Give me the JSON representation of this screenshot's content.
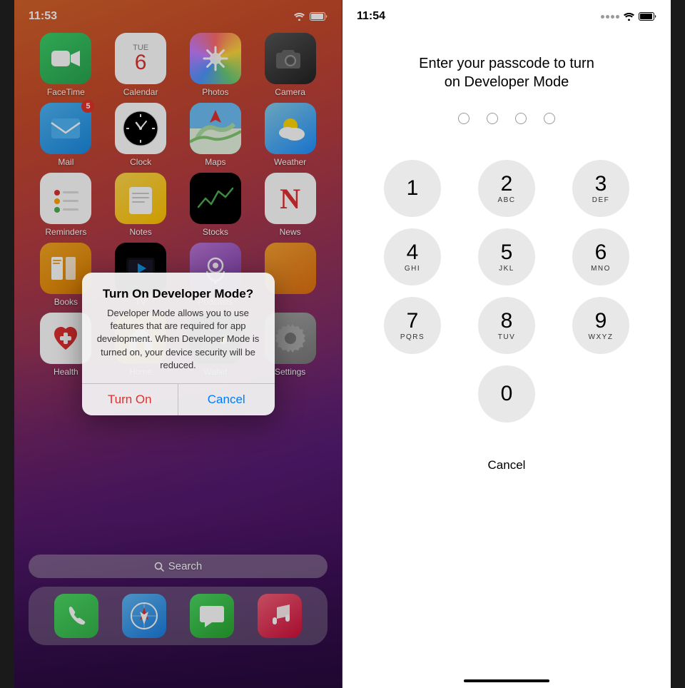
{
  "left_phone": {
    "status_bar": {
      "time": "11:53",
      "wifi": "wifi",
      "battery": "battery"
    },
    "apps_row1": [
      {
        "label": "FaceTime",
        "icon_class": "icon-facetime",
        "icon_char": "📹"
      },
      {
        "label": "Calendar",
        "icon_class": "icon-calendar",
        "special": "calendar"
      },
      {
        "label": "Photos",
        "icon_class": "icon-photos",
        "special": "photos"
      },
      {
        "label": "Camera",
        "icon_class": "icon-camera",
        "icon_char": "📷"
      }
    ],
    "apps_row2": [
      {
        "label": "Mail",
        "icon_class": "icon-mail",
        "icon_char": "✉️",
        "badge": "5"
      },
      {
        "label": "Clock",
        "icon_class": "icon-clock",
        "special": "clock"
      },
      {
        "label": "Maps",
        "icon_class": "icon-maps",
        "icon_char": "🗺️"
      },
      {
        "label": "Weather",
        "icon_class": "icon-weather",
        "icon_char": "⛅"
      }
    ],
    "apps_row3": [
      {
        "label": "Reminders",
        "icon_class": "icon-reminders",
        "special": "reminders"
      },
      {
        "label": "Notes",
        "icon_class": "icon-notes",
        "icon_char": "📝"
      },
      {
        "label": "Stocks",
        "icon_class": "icon-stocks",
        "special": "stocks"
      },
      {
        "label": "News",
        "icon_class": "icon-news",
        "special": "news"
      }
    ],
    "apps_row4": [
      {
        "label": "Books",
        "icon_class": "icon-books",
        "icon_char": "📚"
      },
      {
        "label": "TV",
        "icon_class": "icon-tv",
        "icon_char": "📺"
      },
      {
        "label": "Podcasts",
        "icon_class": "icon-podcasts",
        "icon_char": "🎙️"
      },
      {
        "label": "",
        "icon_class": "icon-orange",
        "icon_char": ""
      }
    ],
    "apps_bottom": [
      {
        "label": "Health",
        "icon_class": "icon-health",
        "icon_char": "❤️"
      },
      {
        "label": "Home",
        "icon_class": "icon-home",
        "icon_char": "🏠"
      },
      {
        "label": "Wallet",
        "icon_class": "icon-wallet",
        "icon_char": "💳"
      },
      {
        "label": "Settings",
        "icon_class": "icon-settings",
        "icon_char": "⚙️"
      }
    ],
    "dialog": {
      "title": "Turn On Developer Mode?",
      "message": "Developer Mode allows you to use features that are required for app development. When Developer Mode is turned on, your device security will be reduced.",
      "btn_turn_on": "Turn On",
      "btn_cancel": "Cancel"
    },
    "search_bar": {
      "text": "Search",
      "icon": "search"
    },
    "dock": [
      {
        "label": "Phone",
        "icon_class": "icon-phone",
        "icon_char": "📞"
      },
      {
        "label": "Safari",
        "icon_class": "icon-safari",
        "icon_char": "🧭"
      },
      {
        "label": "Messages",
        "icon_class": "icon-messages",
        "icon_char": "💬"
      },
      {
        "label": "Music",
        "icon_class": "icon-music",
        "icon_char": "🎵"
      }
    ],
    "calendar_day": "TUE",
    "calendar_date": "6"
  },
  "right_phone": {
    "status_bar": {
      "time": "11:54",
      "wifi": "wifi",
      "battery": "battery"
    },
    "passcode_title": "Enter your passcode to turn on Developer Mode",
    "passcode_dots_count": 4,
    "numpad": [
      {
        "num": "1",
        "letters": ""
      },
      {
        "num": "2",
        "letters": "ABC"
      },
      {
        "num": "3",
        "letters": "DEF"
      },
      {
        "num": "4",
        "letters": "GHI"
      },
      {
        "num": "5",
        "letters": "JKL"
      },
      {
        "num": "6",
        "letters": "MNO"
      },
      {
        "num": "7",
        "letters": "PQRS"
      },
      {
        "num": "8",
        "letters": "TUV"
      },
      {
        "num": "9",
        "letters": "WXYZ"
      },
      {
        "num": "0",
        "letters": ""
      }
    ],
    "cancel_label": "Cancel"
  }
}
